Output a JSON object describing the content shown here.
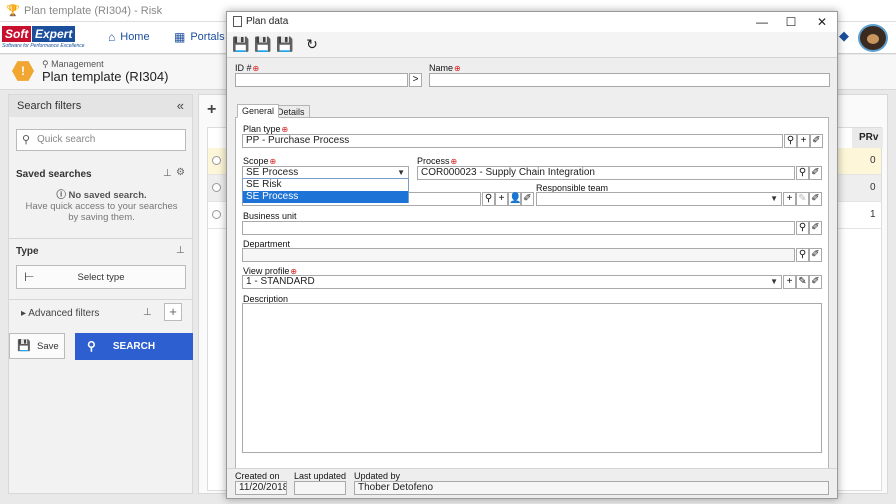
{
  "window": {
    "title": "Plan template (RI304) - Risk"
  },
  "nav": {
    "logo_left": "Soft",
    "logo_right": "Expert",
    "logo_tagline": "Software for Performance Excellence",
    "home": "Home",
    "portals": "Portals"
  },
  "page": {
    "breadcrumb": "Management",
    "title": "Plan template (RI304)"
  },
  "filters": {
    "header": "Search filters",
    "quick_search_placeholder": "Quick search",
    "saved_searches": "Saved searches",
    "no_saved": "No saved search.",
    "no_saved_hint": "Have quick access to your searches by saving them.",
    "type": "Type",
    "select_type": "Select type",
    "advanced": "Advanced filters",
    "save": "Save",
    "search": "SEARCH"
  },
  "bglist": {
    "col_prv": "PRv",
    "rows": [
      "0",
      "0",
      "1"
    ]
  },
  "dialog": {
    "title": "Plan data",
    "id_label": "ID #",
    "id_value": "",
    "name_label": "Name",
    "name_value": "",
    "tabs": [
      "General",
      "Details"
    ],
    "plan_type_label": "Plan type",
    "plan_type_value": "PP - Purchase Process",
    "scope_label": "Scope",
    "scope_value": "SE Process",
    "scope_options": [
      "SE Risk",
      "SE Process"
    ],
    "process_label": "Process",
    "process_value": "COR000023 - Supply Chain Integration",
    "responsible_team_label": "Responsible team",
    "responsible_team_value": "",
    "business_unit_label": "Business unit",
    "department_label": "Department",
    "view_profile_label": "View profile",
    "view_profile_value": "1 - STANDARD",
    "description_label": "Description",
    "created_on_label": "Created on",
    "created_on_value": "11/20/2018",
    "last_updated_label": "Last updated",
    "last_updated_value": "",
    "updated_by_label": "Updated by",
    "updated_by_value": "Thober Detofeno"
  }
}
